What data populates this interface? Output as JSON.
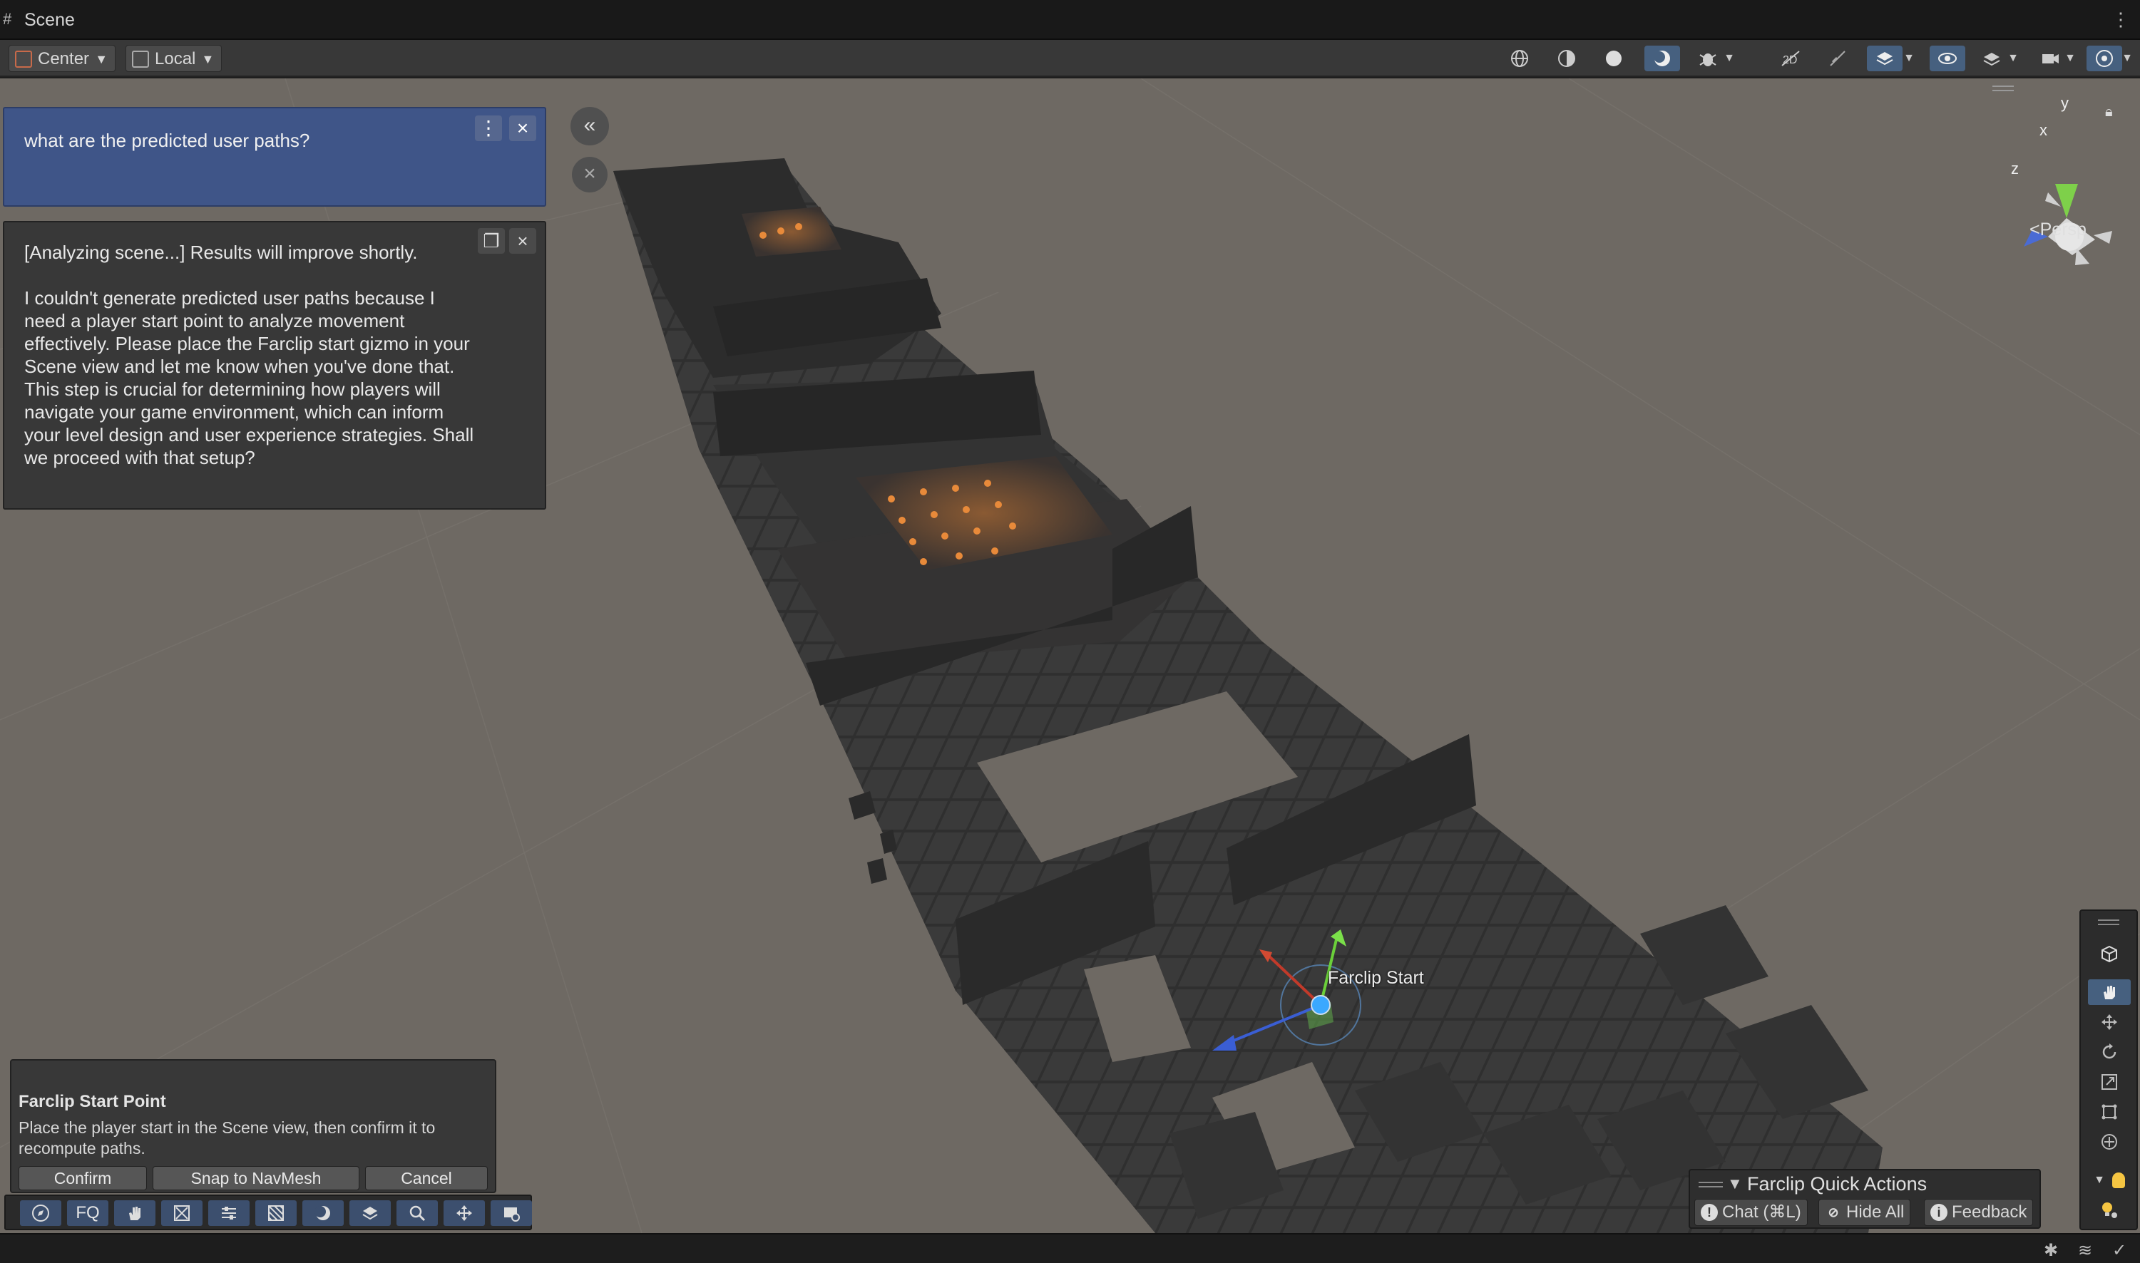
{
  "tab": {
    "title": "Scene",
    "icon": "grid-icon",
    "menu_icon": "kebab-menu-icon"
  },
  "toolbar": {
    "pivot_label": "Center",
    "space_label": "Local"
  },
  "chat": {
    "query": "what are the predicted user paths?",
    "response": "[Analyzing scene...] Results will improve shortly.\n\nI couldn't generate predicted user paths because I need a player start point to analyze movement effectively. Please place the Farclip start gizmo in your Scene view and let me know when you've done that. This step is crucial for determining how players will navigate your game environment, which can inform your level design and user experience strategies. Shall we proceed with that setup?"
  },
  "start_point": {
    "title": "Farclip Start Point",
    "description": "Place the player start in the Scene view, then confirm it to recompute paths.",
    "confirm_label": "Confirm",
    "snap_label": "Snap to NavMesh",
    "cancel_label": "Cancel"
  },
  "bottom_toolbar": {
    "fq_label": "FQ"
  },
  "gizmo": {
    "y": "y",
    "x": "x",
    "z": "z",
    "persp_label": "Persp"
  },
  "scene_labels": {
    "farclip_start": "Farclip Start"
  },
  "quick_actions": {
    "title": "Farclip Quick Actions",
    "chat_label": "Chat (⌘L)",
    "hide_label": "Hide All",
    "feedback_label": "Feedback"
  },
  "colors": {
    "accent": "#46607f",
    "query_bg": "#3f5588",
    "ground": "#6e6963"
  }
}
